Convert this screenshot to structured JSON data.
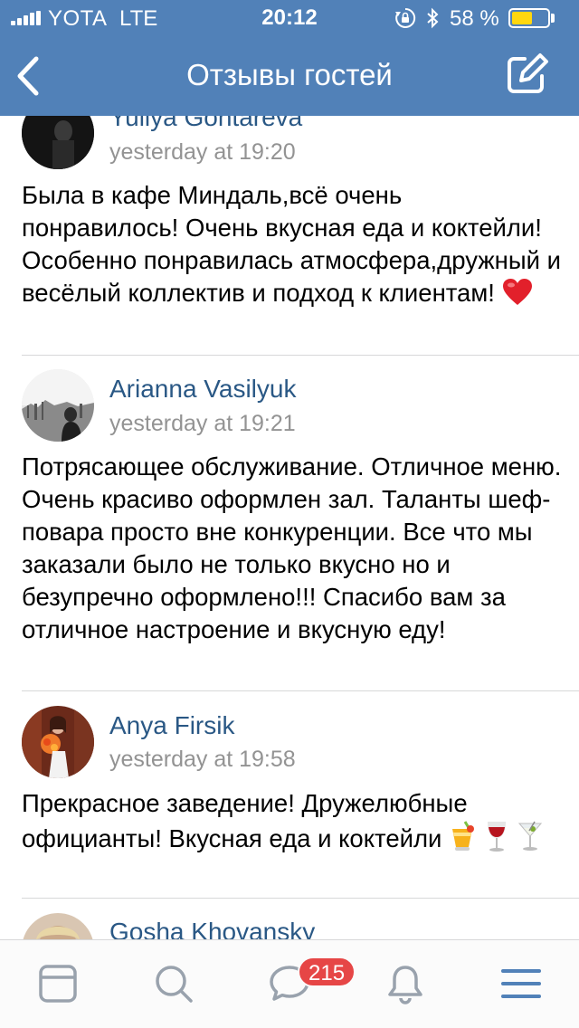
{
  "status_bar": {
    "carrier": "YOTA",
    "network": "LTE",
    "time": "20:12",
    "battery_percent": "58 %",
    "battery_level": 0.58,
    "battery_color": "#ffd70f",
    "icons": [
      "signal-icon",
      "orientation-lock-icon",
      "bluetooth-icon",
      "battery-icon"
    ]
  },
  "nav": {
    "title": "Отзывы гостей",
    "back_icon": "chevron-left-icon",
    "edit_icon": "compose-icon",
    "background": "#5181b8"
  },
  "reviews": [
    {
      "author": "Yuliya Gontareva",
      "time": "yesterday at 19:20",
      "text": "Была в кафе Миндаль,всё очень понравилось! Очень вкусная еда и коктейли! Особенно понравилась атмосфера,дружный и весёлый коллектив и подход к клиентам!",
      "emoji": [
        "red-heart"
      ]
    },
    {
      "author": "Arianna Vasilyuk",
      "time": "yesterday at 19:21",
      "text": "Потрясающее обслуживание. Отличное меню. Очень красиво оформлен зал. Таланты шеф-повара просто вне конкуренции. Все что мы заказали было не только вкусно но и безупречно оформлено!!! Спасибо вам за отличное настроение и вкусную еду!",
      "emoji": []
    },
    {
      "author": "Anya Firsik",
      "time": "yesterday at 19:58",
      "text": "Прекрасное заведение! Дружелюбные официанты! Вкусная еда и коктейли",
      "emoji": [
        "tropical-drink",
        "wine-glass",
        "cocktail-glass"
      ]
    },
    {
      "author": "Gosha Khovansky",
      "time": "",
      "text": "",
      "emoji": []
    }
  ],
  "tabbar": {
    "items": [
      {
        "name": "news",
        "icon": "news-icon"
      },
      {
        "name": "search",
        "icon": "search-icon"
      },
      {
        "name": "messages",
        "icon": "messages-icon"
      },
      {
        "name": "notifications",
        "icon": "bell-icon"
      },
      {
        "name": "menu",
        "icon": "menu-icon"
      }
    ],
    "messages_badge": "215",
    "active": "menu",
    "active_color": "#5181b8",
    "inactive_color": "#99a2ad"
  }
}
